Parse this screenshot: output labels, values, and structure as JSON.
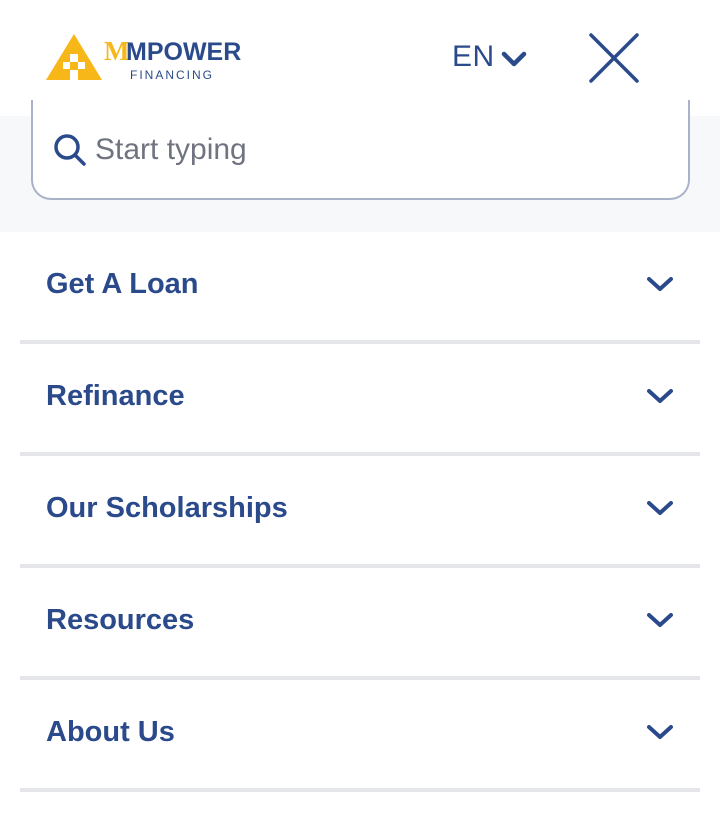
{
  "brand": {
    "name": "MPOWER",
    "tagline": "FINANCING",
    "logo_icon": "mpower-triangle-logo",
    "colors": {
      "primary": "#2b4a8b",
      "accent": "#f7b718",
      "divider": "#e4e6ea"
    }
  },
  "header": {
    "language": "EN",
    "language_icon": "chevron-down-icon",
    "close_icon": "close-icon"
  },
  "search": {
    "placeholder": "Start typing",
    "value": "",
    "icon": "search-icon"
  },
  "menu": {
    "items": [
      {
        "label": "Get A Loan",
        "icon": "chevron-down-icon"
      },
      {
        "label": "Refinance",
        "icon": "chevron-down-icon"
      },
      {
        "label": "Our Scholarships",
        "icon": "chevron-down-icon"
      },
      {
        "label": "Resources",
        "icon": "chevron-down-icon"
      },
      {
        "label": "About Us",
        "icon": "chevron-down-icon"
      }
    ]
  }
}
